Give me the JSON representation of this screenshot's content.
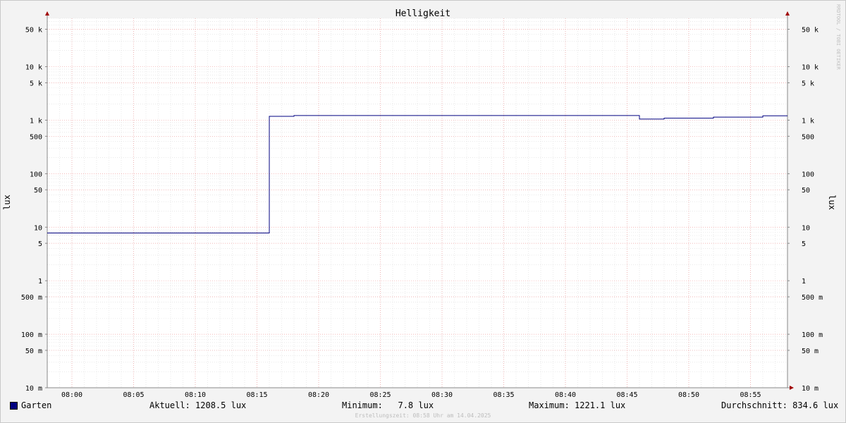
{
  "chart_data": {
    "type": "line",
    "title": "Helligkeit",
    "ylabel": "lux",
    "ylabel_right": "lux",
    "yscale": "log",
    "ylim": [
      0.01,
      80000
    ],
    "xlim": [
      "07:58",
      "08:58"
    ],
    "x_ticks": [
      "08:00",
      "08:05",
      "08:10",
      "08:15",
      "08:20",
      "08:25",
      "08:30",
      "08:35",
      "08:40",
      "08:45",
      "08:50",
      "08:55"
    ],
    "y_ticks": [
      {
        "value": 50000,
        "label": "50 k"
      },
      {
        "value": 10000,
        "label": "10 k"
      },
      {
        "value": 5000,
        "label": "5 k"
      },
      {
        "value": 1000,
        "label": "1 k"
      },
      {
        "value": 500,
        "label": "500"
      },
      {
        "value": 100,
        "label": "100"
      },
      {
        "value": 50,
        "label": "50"
      },
      {
        "value": 10,
        "label": "10"
      },
      {
        "value": 5,
        "label": "5"
      },
      {
        "value": 1,
        "label": "1"
      },
      {
        "value": 0.5,
        "label": "500 m"
      },
      {
        "value": 0.1,
        "label": "100 m"
      },
      {
        "value": 0.05,
        "label": "50 m"
      },
      {
        "value": 0.01,
        "label": "10 m"
      }
    ],
    "grid": true,
    "series": [
      {
        "name": "Garten",
        "color": "#000080",
        "step": true,
        "points": [
          {
            "x": "07:58",
            "y": 7.8
          },
          {
            "x": "08:16",
            "y": 1180
          },
          {
            "x": "08:18",
            "y": 1221.1
          },
          {
            "x": "08:46",
            "y": 1050
          },
          {
            "x": "08:48",
            "y": 1090
          },
          {
            "x": "08:52",
            "y": 1140
          },
          {
            "x": "08:56",
            "y": 1208.5
          },
          {
            "x": "08:58",
            "y": 1208.5
          }
        ]
      }
    ],
    "watermark": "RRDTOOL / TOBI OETIKER"
  },
  "legend": {
    "series_name": "Garten",
    "series_color": "#000080",
    "current": "Aktuell: 1208.5 lux",
    "minimum": "Minimum:   7.8 lux",
    "maximum": "Maximum: 1221.1 lux",
    "average": "Durchschnitt: 834.6 lux"
  },
  "footer": "Erstellungszeit: 08:58 Uhr am 14.04.2025"
}
